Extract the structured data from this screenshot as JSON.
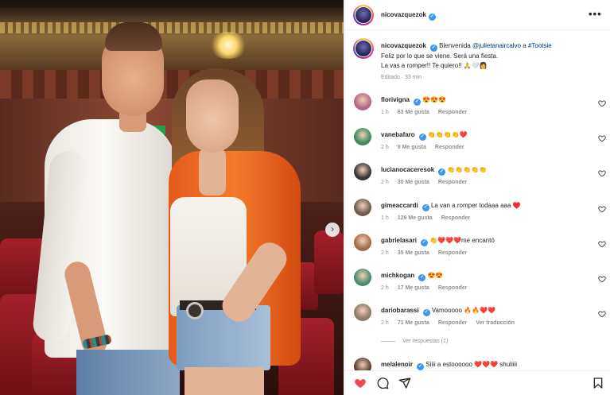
{
  "post": {
    "author": "nicovazquezok",
    "caption_greeting": "Bienvenida",
    "caption_mention": "@julietanaircalvo",
    "caption_mid": "a",
    "caption_hashtag": "#Tootsie",
    "caption_line2": "Feliz por lo que se viene. Será una fiesta.",
    "caption_line3": "La vas a romper!! Te quiero!! 🙏🤍👩",
    "edited": "Editado · 33 min"
  },
  "comments": [
    {
      "user": "florivigna",
      "text": "😍😍😍",
      "time": "1 h",
      "likes": "63 Me gusta",
      "reply": "Responder",
      "extra": "",
      "avatar_color": "#b5648a"
    },
    {
      "user": "vanebafaro",
      "text": "👏👏👏👏❤️",
      "time": "2 h",
      "likes": "9 Me gusta",
      "reply": "Responder",
      "extra": "",
      "avatar_color": "#3d8a5a"
    },
    {
      "user": "lucianocaceresok",
      "text": "👏👏👏👏👏",
      "time": "2 h",
      "likes": "30 Me gusta",
      "reply": "Responder",
      "extra": "",
      "avatar_color": "#333333"
    },
    {
      "user": "gimeaccardi",
      "text": "La van a romper todaaa aaa ♥️",
      "time": "1 h",
      "likes": "129 Me gusta",
      "reply": "Responder",
      "extra": "",
      "avatar_color": "#6b5a4a"
    },
    {
      "user": "gabrielasari",
      "text": "👏❤️❤️❤️me encantó",
      "time": "2 h",
      "likes": "35 Me gusta",
      "reply": "Responder",
      "extra": "",
      "avatar_color": "#a06a48"
    },
    {
      "user": "michkogan",
      "text": "😍😍",
      "time": "2 h",
      "likes": "17 Me gusta",
      "reply": "Responder",
      "extra": "",
      "avatar_color": "#4a8a6a"
    },
    {
      "user": "dariobarassi",
      "text": "Vamooooo 🔥🔥❤️❤️",
      "time": "2 h",
      "likes": "71 Me gusta",
      "reply": "Responder",
      "extra": "Ver traducción",
      "avatar_color": "#8a7a6a"
    },
    {
      "user": "melalenoir",
      "text": "Siiii a estoooooo ❤️❤️❤️ shuliiii",
      "time": "",
      "likes": "",
      "reply": "",
      "extra": "",
      "avatar_color": "#5a4030"
    }
  ],
  "replies_link": "Ver respuestas (1)",
  "icons": [
    "more-options-icon",
    "verified-badge-icon",
    "heart-icon",
    "comment-icon",
    "share-icon",
    "bookmark-icon",
    "chevron-right-icon"
  ],
  "colors": {
    "verified": "#3897f0",
    "like_red": "#ed4956",
    "mention": "#00376b",
    "muted": "#8e8e8e"
  }
}
